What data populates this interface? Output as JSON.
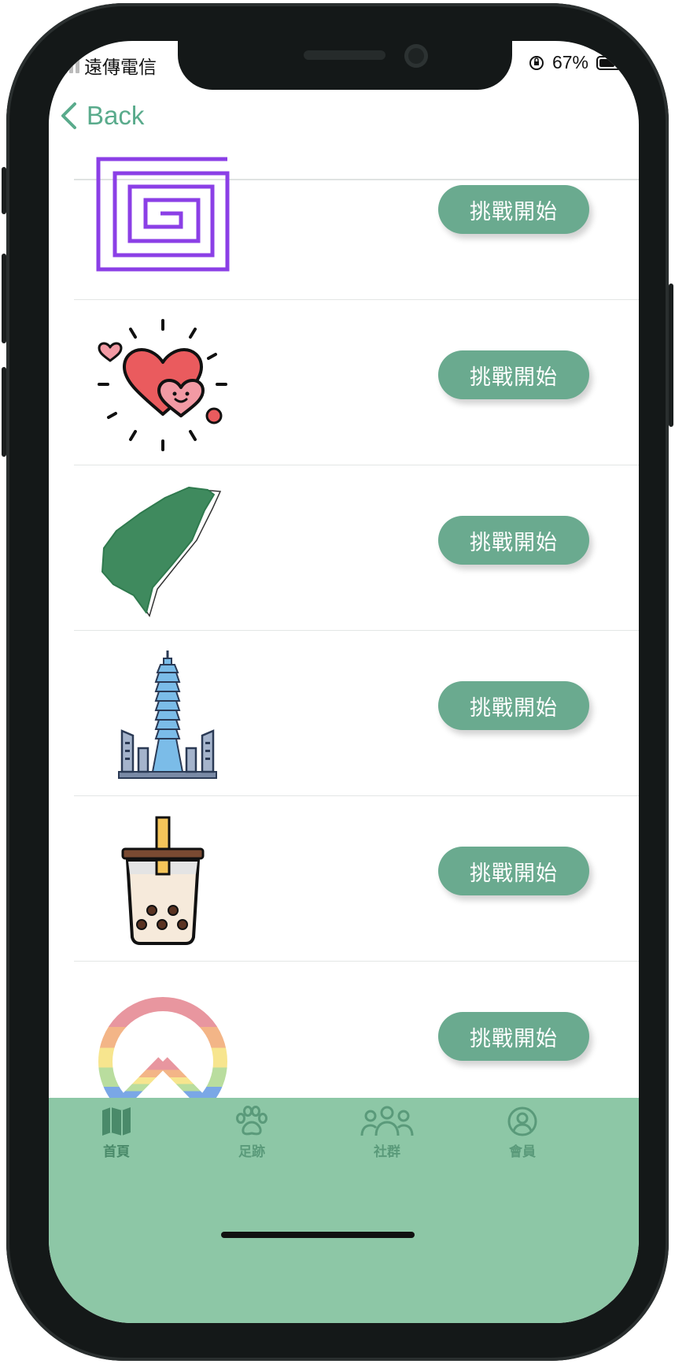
{
  "status_bar": {
    "carrier": "遠傳電信",
    "battery_percent": "67%",
    "battery_level": 0.67
  },
  "nav": {
    "back_label": "Back"
  },
  "challenges": [
    {
      "icon": "maze-icon",
      "button_label": "挑戰開始"
    },
    {
      "icon": "hearts-icon",
      "button_label": "挑戰開始"
    },
    {
      "icon": "taiwan-map-icon",
      "button_label": "挑戰開始"
    },
    {
      "icon": "taipei-101-icon",
      "button_label": "挑戰開始"
    },
    {
      "icon": "bubble-tea-icon",
      "button_label": "挑戰開始"
    },
    {
      "icon": "rainbow-peace-icon",
      "button_label": "挑戰開始"
    }
  ],
  "tab_bar": {
    "tabs": [
      {
        "label": "首頁",
        "icon": "map-icon"
      },
      {
        "label": "足跡",
        "icon": "paw-icon"
      },
      {
        "label": "社群",
        "icon": "group-icon"
      },
      {
        "label": "會員",
        "icon": "user-circle-icon"
      }
    ]
  },
  "colors": {
    "accent": "#5aab8c",
    "button": "#6aaa8f",
    "tab_bar": "#8dc7a6",
    "tab_icon": "#5a9a7a"
  }
}
